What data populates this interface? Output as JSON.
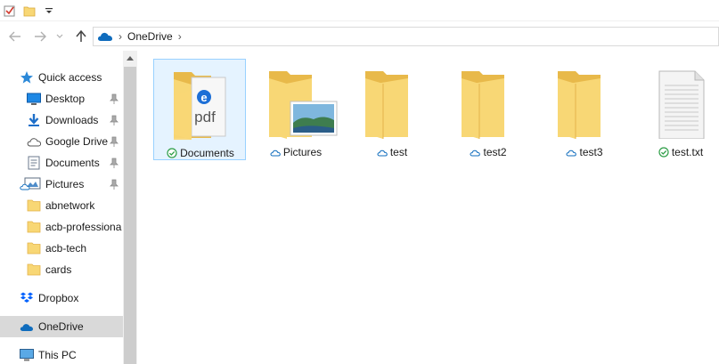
{
  "nav": {
    "location_icon": "onedrive-cloud-icon",
    "breadcrumb": [
      "OneDrive"
    ]
  },
  "sidebar": {
    "quick_access": "Quick access",
    "pinned": [
      {
        "label": "Desktop",
        "icon": "desktop-icon"
      },
      {
        "label": "Downloads",
        "icon": "downloads-icon"
      },
      {
        "label": "Google Drive",
        "icon": "google-drive-icon"
      },
      {
        "label": "Documents",
        "icon": "documents-icon"
      },
      {
        "label": "Pictures",
        "icon": "pictures-icon"
      }
    ],
    "recent": [
      {
        "label": "abnetwork",
        "icon": "folder-icon"
      },
      {
        "label": "acb-professiona",
        "icon": "folder-icon"
      },
      {
        "label": "acb-tech",
        "icon": "folder-icon"
      },
      {
        "label": "cards",
        "icon": "folder-icon"
      }
    ],
    "dropbox": "Dropbox",
    "onedrive": "OneDrive",
    "this_pc": "This PC"
  },
  "items": [
    {
      "name": "Documents",
      "status": "synced",
      "kind": "folder-pdf"
    },
    {
      "name": "Pictures",
      "status": "cloud",
      "kind": "folder-pictures"
    },
    {
      "name": "test",
      "status": "cloud",
      "kind": "folder"
    },
    {
      "name": "test2",
      "status": "cloud",
      "kind": "folder"
    },
    {
      "name": "test3",
      "status": "cloud",
      "kind": "folder"
    },
    {
      "name": "test.txt",
      "status": "synced",
      "kind": "text-file"
    }
  ],
  "pdf_badge": "pdf",
  "colors": {
    "folder": "#f8d775",
    "folder_dark": "#e8b94a",
    "accent": "#0078d7",
    "synced": "#2e9e47",
    "selection": "#e5f3ff",
    "selection_border": "#99d1ff"
  }
}
